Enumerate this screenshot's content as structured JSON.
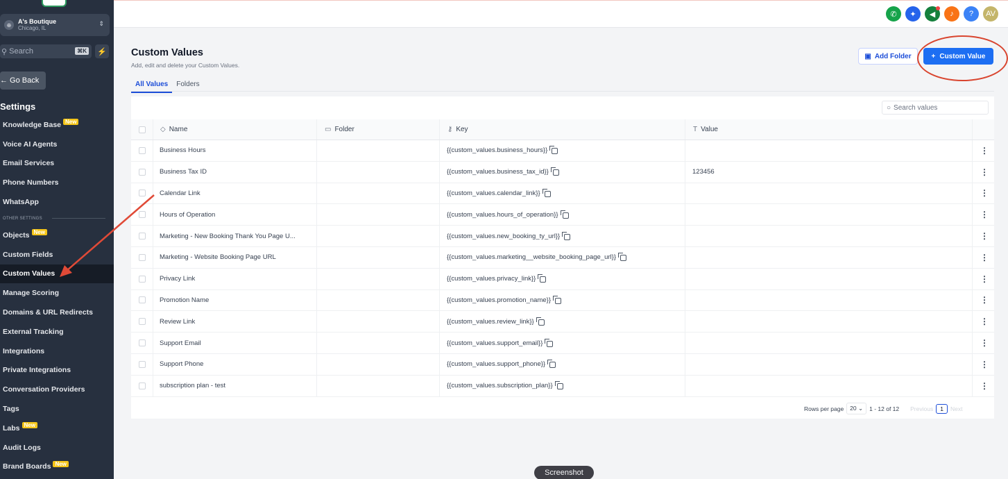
{
  "sidebar": {
    "account": {
      "name": "A's Boutique",
      "location": "Chicago, IL"
    },
    "search": {
      "placeholder": "Search",
      "shortcut": "⌘K"
    },
    "go_back": "← Go Back",
    "settings_title": "Settings",
    "items_top": [
      {
        "label": "Knowledge Base",
        "badge": "New"
      },
      {
        "label": "Voice AI Agents"
      },
      {
        "label": "Email Services"
      },
      {
        "label": "Phone Numbers"
      },
      {
        "label": "WhatsApp"
      }
    ],
    "section_label": "OTHER SETTINGS",
    "items_other": [
      {
        "label": "Objects",
        "badge": "New"
      },
      {
        "label": "Custom Fields"
      },
      {
        "label": "Custom Values",
        "active": true
      },
      {
        "label": "Manage Scoring"
      },
      {
        "label": "Domains & URL Redirects"
      },
      {
        "label": "External Tracking"
      },
      {
        "label": "Integrations"
      },
      {
        "label": "Private Integrations"
      },
      {
        "label": "Conversation Providers"
      },
      {
        "label": "Tags"
      },
      {
        "label": "Labs",
        "badge": "New"
      },
      {
        "label": "Audit Logs"
      },
      {
        "label": "Brand Boards",
        "badge": "New"
      }
    ]
  },
  "topbar": {
    "icons": [
      {
        "name": "phone-icon",
        "glyph": "✆",
        "color": "#16a34a"
      },
      {
        "name": "magic-icon",
        "glyph": "✦",
        "color": "#2563eb"
      },
      {
        "name": "megaphone-icon",
        "glyph": "◀",
        "color": "#15803d",
        "dot": true
      },
      {
        "name": "bell-icon",
        "glyph": "♪",
        "color": "#f97316"
      },
      {
        "name": "help-icon",
        "glyph": "?",
        "color": "#3b82f6"
      },
      {
        "name": "user-avatar",
        "glyph": "AV",
        "color": "#c4b56a"
      }
    ]
  },
  "main": {
    "title": "Custom Values",
    "subtitle": "Add, edit and delete your Custom Values.",
    "tabs": [
      "All Values",
      "Folders"
    ],
    "add_folder": "Add Folder",
    "add_custom_value": "Custom Value",
    "search_placeholder": "Search values",
    "columns": {
      "name": "Name",
      "folder": "Folder",
      "key": "Key",
      "value": "Value"
    },
    "rows": [
      {
        "name": "Business Hours",
        "folder": "",
        "key": "{{custom_values.business_hours}}",
        "value": ""
      },
      {
        "name": "Business Tax ID",
        "folder": "",
        "key": "{{custom_values.business_tax_id}}",
        "value": "123456"
      },
      {
        "name": "Calendar Link",
        "folder": "",
        "key": "{{custom_values.calendar_link}}",
        "value": ""
      },
      {
        "name": "Hours of Operation",
        "folder": "",
        "key": "{{custom_values.hours_of_operation}}",
        "value": ""
      },
      {
        "name": "Marketing - New Booking Thank You Page U...",
        "folder": "",
        "key": "{{custom_values.new_booking_ty_url}}",
        "value": ""
      },
      {
        "name": "Marketing - Website Booking Page URL",
        "folder": "",
        "key": "{{custom_values.marketing__website_booking_page_url}}",
        "value": ""
      },
      {
        "name": "Privacy Link",
        "folder": "",
        "key": "{{custom_values.privacy_link}}",
        "value": ""
      },
      {
        "name": "Promotion Name",
        "folder": "",
        "key": "{{custom_values.promotion_name}}",
        "value": ""
      },
      {
        "name": "Review Link",
        "folder": "",
        "key": "{{custom_values.review_link}}",
        "value": ""
      },
      {
        "name": "Support Email",
        "folder": "",
        "key": "{{custom_values.support_email}}",
        "value": ""
      },
      {
        "name": "Support Phone",
        "folder": "",
        "key": "{{custom_values.support_phone}}",
        "value": ""
      },
      {
        "name": "subscription plan - test",
        "folder": "",
        "key": "{{custom_values.subscription_plan}}",
        "value": ""
      }
    ],
    "pagination": {
      "rows_per_page_label": "Rows per page",
      "rows_per_page": "20",
      "range": "1 - 12 of 12",
      "previous": "Previous",
      "page": "1",
      "next": "Next"
    }
  },
  "overlay": {
    "screenshot_label": "Screenshot"
  },
  "colors": {
    "sidebar_bg": "#27303f",
    "accent": "#1d6ef2",
    "annotation_red": "#d9452f"
  }
}
